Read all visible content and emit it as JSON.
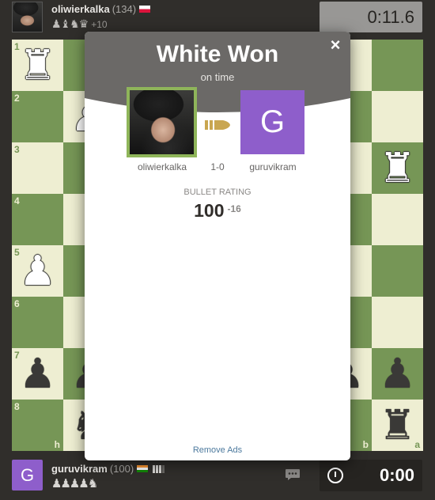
{
  "top_player": {
    "name": "oliwierkalka",
    "rating": "(134)",
    "country_flag": "flag-poland",
    "captured_pieces": "♟♝♞♛",
    "material_advantage": "+10",
    "clock": "0:11.6"
  },
  "board": {
    "light_color": "#eeeed2",
    "dark_color": "#769656",
    "rank_labels": [
      "1",
      "2",
      "3",
      "4",
      "5",
      "6",
      "7",
      "8"
    ],
    "file_labels_visible": [
      "h",
      "b",
      "a"
    ],
    "pieces": [
      {
        "square": "h1",
        "glyph": "♜",
        "color": "white"
      },
      {
        "square": "g2",
        "glyph": "♟",
        "color": "white"
      },
      {
        "square": "a3",
        "glyph": "♜",
        "color": "white"
      },
      {
        "square": "h5",
        "glyph": "♟",
        "color": "white"
      },
      {
        "square": "h7",
        "glyph": "♟",
        "color": "black"
      },
      {
        "square": "g7",
        "glyph": "♟",
        "color": "black"
      },
      {
        "square": "b7",
        "glyph": "♟",
        "color": "black"
      },
      {
        "square": "a7",
        "glyph": "♟",
        "color": "black"
      },
      {
        "square": "g8",
        "glyph": "♞",
        "color": "black"
      },
      {
        "square": "a8",
        "glyph": "♜",
        "color": "black"
      }
    ]
  },
  "modal": {
    "title": "White Won",
    "subtitle": "on time",
    "close_label": "×",
    "winner_name": "oliwierkalka",
    "score": "1-0",
    "loser_name": "guruvikram",
    "loser_avatar_letter": "G",
    "rating_label": "BULLET RATING",
    "rating_value": "100",
    "rating_change": "-16",
    "remove_ads_label": "Remove Ads",
    "header_color": "#6b6967",
    "winner_border_color": "#8fb55a",
    "link_color": "#4d7a9e"
  },
  "bottom_player": {
    "avatar_letter": "G",
    "avatar_color": "#8e5ecb",
    "name": "guruvikram",
    "rating": "(100)",
    "country_flag": "flag-india",
    "captured_pieces": "♟♟♟♟♞",
    "clock": "0:00",
    "clock_icon": "clock-icon",
    "chat_icon": "chat-icon"
  }
}
